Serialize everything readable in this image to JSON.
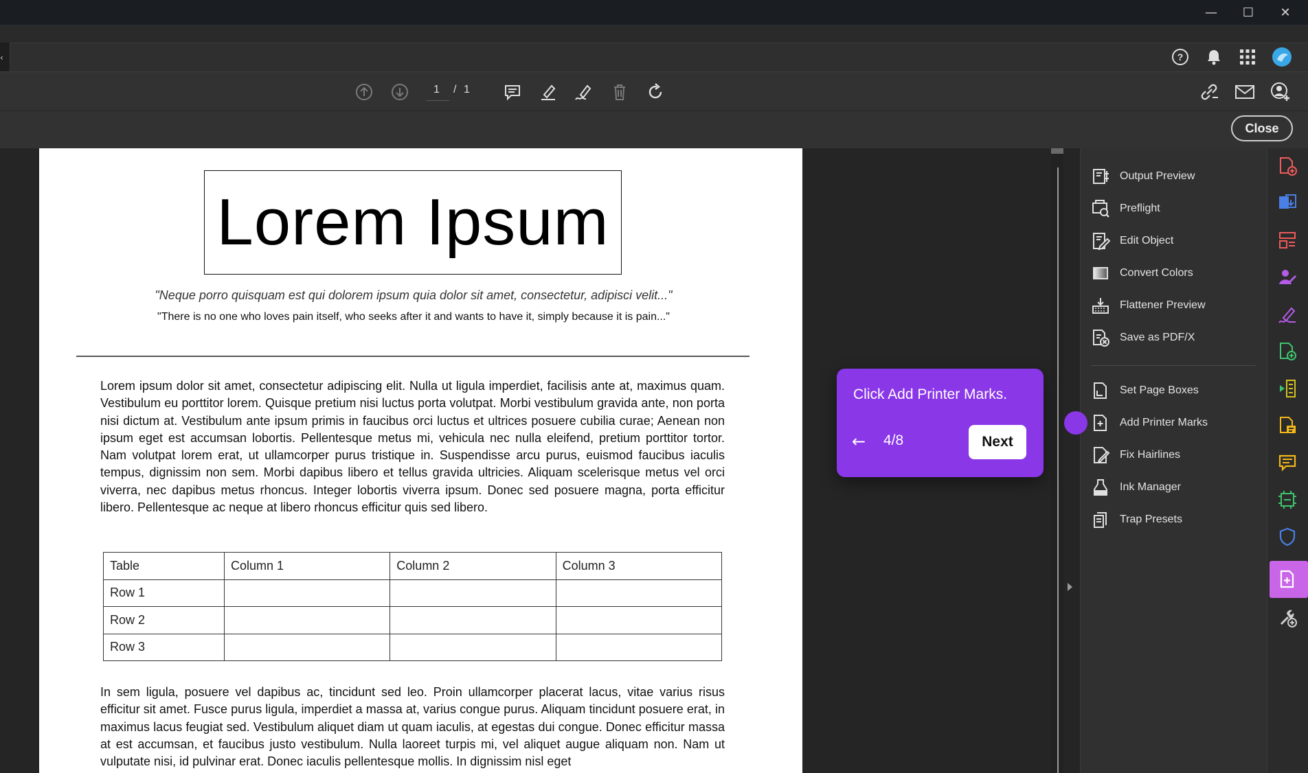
{
  "window": {
    "controls": {
      "minimize": "—",
      "maximize": "☐",
      "close": "✕"
    },
    "collapse_arrow": "‹"
  },
  "header": {
    "icons": [
      "help-icon",
      "bell-icon",
      "apps-grid-icon",
      "profile-icon"
    ]
  },
  "toolbar": {
    "page_current": "1",
    "page_separator": "/",
    "page_total": "1",
    "icons": [
      "page-up-icon",
      "page-down-icon",
      "comment-icon",
      "highlight-icon",
      "sign-icon",
      "delete-icon",
      "rotate-icon",
      "link-icon",
      "email-icon",
      "share-user-icon"
    ]
  },
  "subbar": {
    "close_label": "Close"
  },
  "document": {
    "title": "Lorem Ipsum",
    "quote_latin": "\"Neque porro quisquam est qui dolorem ipsum quia dolor sit amet, consectetur, adipisci velit...\"",
    "quote_english": "\"There is no one who loves pain itself, who seeks after it and wants to have it, simply because it is pain...\"",
    "paragraph1": "Lorem ipsum dolor sit amet, consectetur adipiscing elit. Nulla ut ligula imperdiet, facilisis ante at, maximus quam. Vestibulum eu porttitor lorem. Quisque pretium nisi luctus porta volutpat. Morbi vestibulum gravida ante, non porta nisi dictum at. Vestibulum ante ipsum primis in faucibus orci luctus et ultrices posuere cubilia curae; Aenean non ipsum eget est accumsan lobortis. Pellentesque metus mi, vehicula nec nulla eleifend, pretium porttitor tortor. Nam volutpat lorem erat, ut ullamcorper purus tristique in. Suspendisse arcu purus, euismod faucibus iaculis tempus, dignissim non sem. Morbi dapibus libero et tellus gravida ultricies. Aliquam scelerisque metus vel orci viverra, nec dapibus metus rhoncus. Integer lobortis viverra ipsum. Donec sed posuere magna, porta efficitur libero. Pellentesque ac neque at libero rhoncus efficitur quis sed libero.",
    "table": {
      "header": [
        "Table",
        "Column 1",
        "Column 2",
        "Column 3"
      ],
      "rows": [
        [
          "Row 1",
          "",
          "",
          ""
        ],
        [
          "Row 2",
          "",
          "",
          ""
        ],
        [
          "Row 3",
          "",
          "",
          ""
        ]
      ]
    },
    "paragraph2": "In sem ligula, posuere vel dapibus ac, tincidunt sed leo. Proin ullamcorper placerat lacus, vitae varius risus efficitur sit amet. Fusce purus ligula, imperdiet a massa at, varius congue purus. Aliquam tincidunt posuere erat, in maximus lacus feugiat sed. Vestibulum aliquet diam ut quam iaculis, at egestas dui congue. Donec efficitur massa at est accumsan, et faucibus justo vestibulum. Nulla laoreet turpis mi, vel aliquet augue aliquam non. Nam ut vulputate nisi, id pulvinar erat. Donec iaculis pellentesque mollis. In dignissim nisl eget"
  },
  "tools_panel": {
    "group1": [
      {
        "label": "Output Preview",
        "icon": "output-preview-icon"
      },
      {
        "label": "Preflight",
        "icon": "preflight-icon"
      },
      {
        "label": "Edit Object",
        "icon": "edit-object-icon"
      },
      {
        "label": "Convert Colors",
        "icon": "convert-colors-icon"
      },
      {
        "label": "Flattener Preview",
        "icon": "flattener-preview-icon"
      },
      {
        "label": "Save as PDF/X",
        "icon": "save-pdfx-icon"
      }
    ],
    "group2": [
      {
        "label": "Set Page Boxes",
        "icon": "set-page-boxes-icon"
      },
      {
        "label": "Add Printer Marks",
        "icon": "add-printer-marks-icon"
      },
      {
        "label": "Fix Hairlines",
        "icon": "fix-hairlines-icon"
      },
      {
        "label": "Ink Manager",
        "icon": "ink-manager-icon"
      },
      {
        "label": "Trap Presets",
        "icon": "trap-presets-icon"
      }
    ]
  },
  "right_strip": {
    "icons": [
      "create-pdf-icon",
      "export-pdf-icon",
      "organize-pages-icon",
      "request-signature-icon",
      "fill-sign-icon",
      "scan-ocr-icon",
      "compress-icon",
      "edit-pdf-icon",
      "comment-icon",
      "combine-files-icon",
      "protect-icon",
      "print-production-icon",
      "more-tools-icon"
    ],
    "active_icon": "print-production-icon"
  },
  "tour": {
    "message": "Click Add Printer Marks.",
    "back_arrow": "←",
    "step": "4/8",
    "next_label": "Next"
  },
  "colors": {
    "accent_purple": "#8a37e8",
    "active_tool_pink": "#c966e8",
    "app_dark": "#323232"
  }
}
